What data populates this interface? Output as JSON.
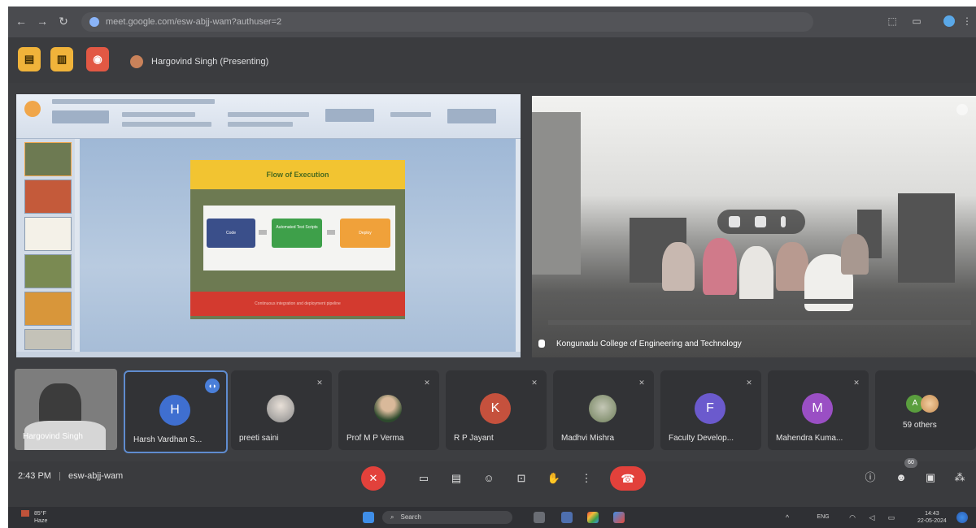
{
  "browser": {
    "url": "meet.google.com/esw-abjj-wam?authuser=2",
    "nav": {
      "back": "←",
      "forward": "→",
      "reload": "↻"
    }
  },
  "header": {
    "presenter_label": "Hargovind Singh (Presenting)"
  },
  "presentation": {
    "slide_title": "Flow of Execution",
    "boxes": [
      "Code",
      "Automated Test Scripts",
      "Deploy"
    ],
    "footer_text": "Continuous integration and deployment pipeline"
  },
  "camera": {
    "label": "Kongunadu College of Engineering and Technology"
  },
  "participants": [
    {
      "name": "Hargovind Singh",
      "type": "self"
    },
    {
      "name": "Harsh Vardhan S...",
      "initial": "H",
      "color": "#3f6fd0",
      "type": "active"
    },
    {
      "name": "preeti saini",
      "type": "photo"
    },
    {
      "name": "Prof M P Verma",
      "type": "photo"
    },
    {
      "name": "R P Jayant",
      "initial": "K",
      "color": "#c5513d",
      "type": "initial"
    },
    {
      "name": "Madhvi Mishra",
      "type": "photo"
    },
    {
      "name": "Faculty Develop...",
      "initial": "F",
      "color": "#6b5acd",
      "type": "initial"
    },
    {
      "name": "Mahendra Kuma...",
      "initial": "M",
      "color": "#9a4fc4",
      "type": "initial"
    },
    {
      "name": "59 others",
      "initial": "A",
      "color": "#5a9e3e",
      "type": "others"
    }
  ],
  "bottom": {
    "time": "2:43 PM",
    "separator": "|",
    "meeting_code": "esw-abjj-wam",
    "people_count": "60"
  },
  "taskbar": {
    "weather_temp": "85°F",
    "weather_desc": "Haze",
    "search_label": "Search",
    "clock_time": "14:43",
    "clock_date": "22-05-2024",
    "lang": "ENG"
  },
  "colors": {
    "end_call": "#e2413b",
    "slide_title_bar": "#f2c431",
    "slide_footer": "#d33a2f",
    "active_border": "#5f8ccf"
  }
}
